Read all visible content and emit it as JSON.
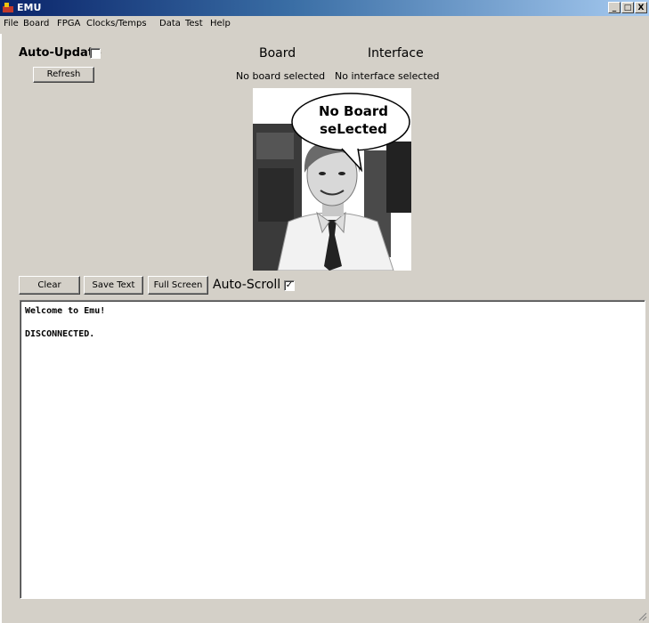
{
  "window": {
    "title": "EMU",
    "controls": [
      "_",
      "□",
      "X"
    ]
  },
  "menu": [
    "File",
    "Board",
    "FPGA",
    "Clocks/Temps",
    "Data",
    "Test",
    "Help"
  ],
  "top": {
    "auto_update_label": "Auto-Update",
    "auto_update_checked": false,
    "refresh_label": "Refresh",
    "board_heading": "Board",
    "interface_heading": "Interface",
    "board_status": "No board selected",
    "interface_status": "No interface selected"
  },
  "picture": {
    "speech_line1": "No Board",
    "speech_line2": "seLected"
  },
  "toolbar": {
    "clear_label": "Clear",
    "save_text_label": "Save Text",
    "full_screen_label": "Full Screen",
    "auto_scroll_label": "Auto-Scroll",
    "auto_scroll_checked": true
  },
  "console": {
    "lines": [
      "Welcome to Emu!",
      "",
      "DISCONNECTED."
    ]
  },
  "colors": {
    "window_bg": "#d4d0c8",
    "title_start": "#0a246a",
    "title_end": "#a6caf0"
  }
}
